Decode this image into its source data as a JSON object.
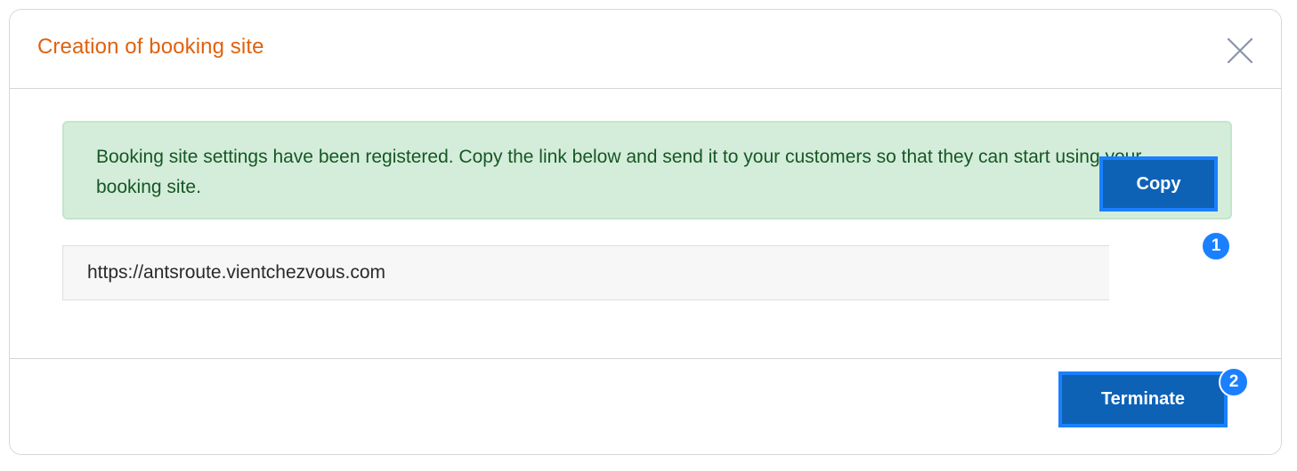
{
  "modal": {
    "title": "Creation of booking site",
    "close_icon": "close-icon"
  },
  "alert": {
    "message": "Booking site settings have been registered. Copy the link below and send it to your customers so that they can start using your booking site."
  },
  "link": {
    "url": "https://antsroute.vientchezvous.com",
    "copy_label": "Copy"
  },
  "footer": {
    "terminate_label": "Terminate"
  },
  "annotations": {
    "badge_1": "1",
    "badge_2": "2"
  },
  "colors": {
    "title": "#e0620e",
    "alert_bg": "#d4edda",
    "alert_text": "#155724",
    "button_bg": "#0d62b6",
    "highlight": "#1a80ff"
  }
}
